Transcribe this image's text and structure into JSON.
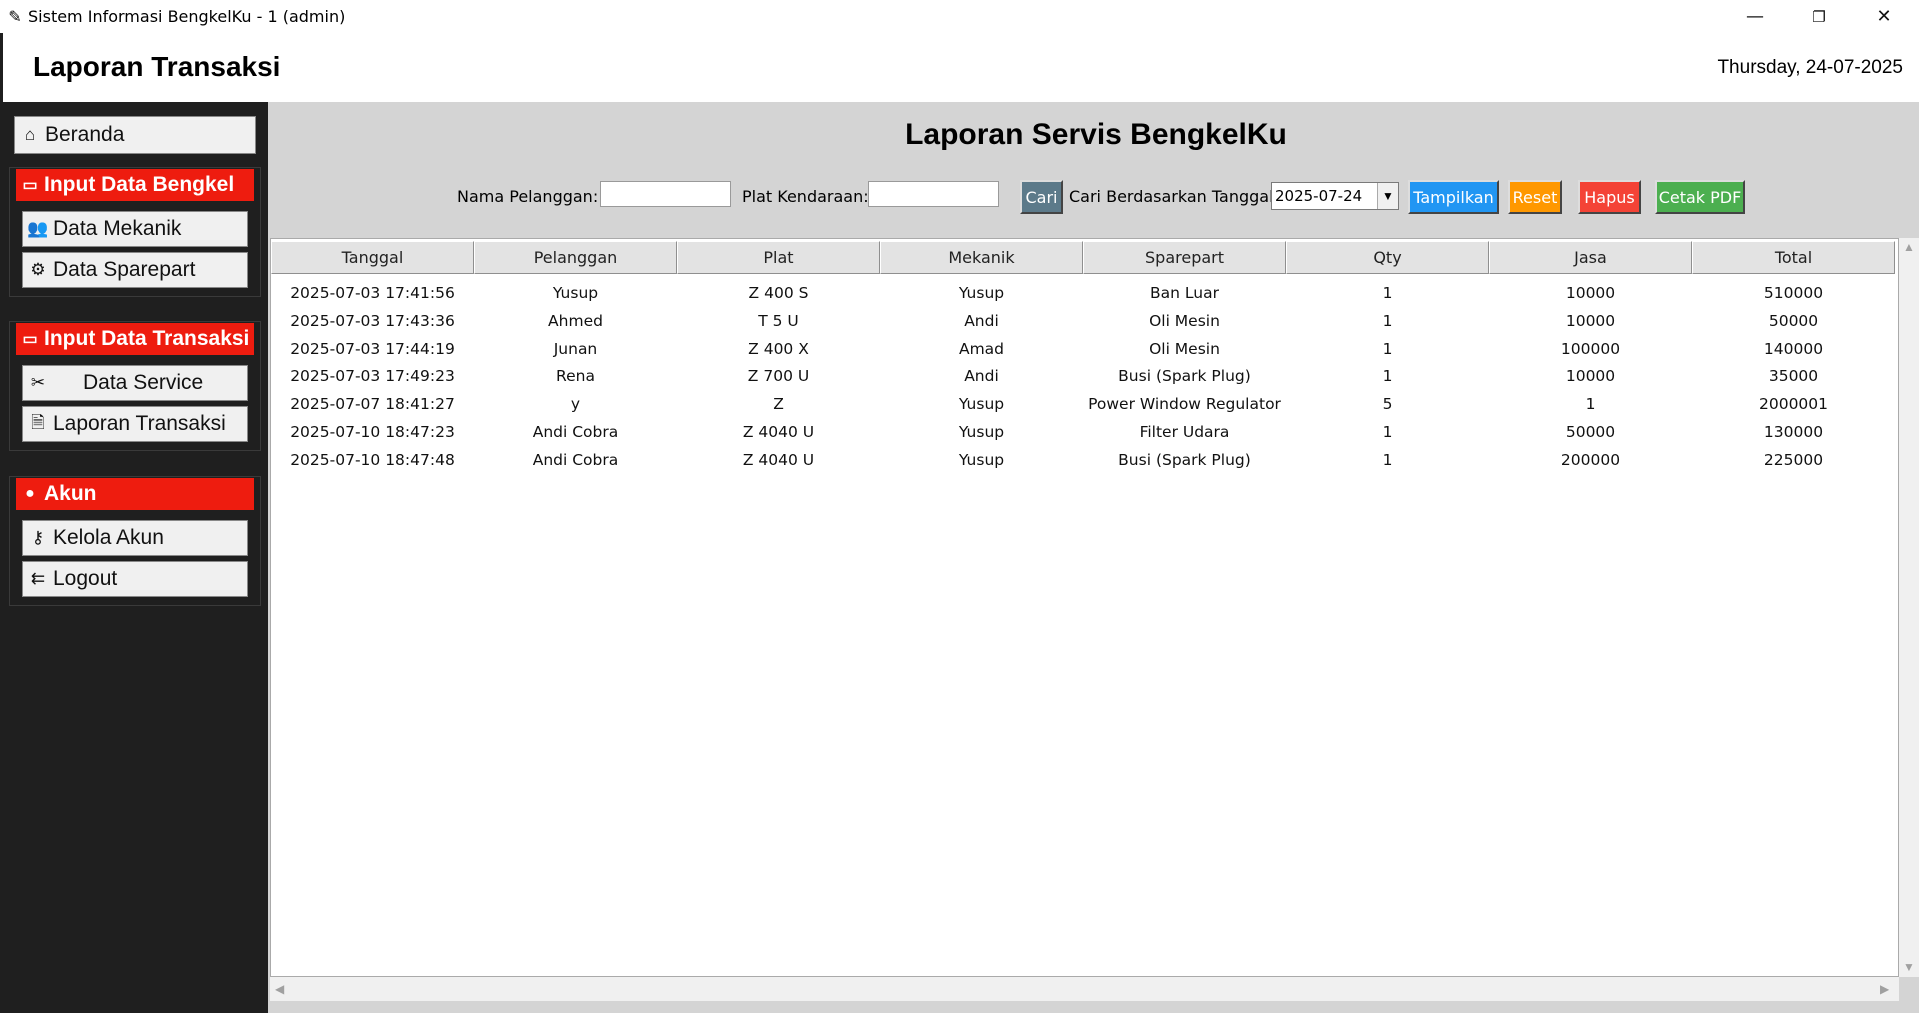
{
  "window": {
    "title": "Sistem Informasi BengkelKu - 1 (admin)",
    "minimize": "—",
    "restore": "❐",
    "close": "✕"
  },
  "header": {
    "title": "Laporan Transaksi",
    "date": "Thursday, 24-07-2025"
  },
  "sidebar": {
    "home": "Beranda",
    "groups": [
      {
        "title": "Input Data Bengkel",
        "items": [
          "Data Mekanik",
          "Data Sparepart"
        ]
      },
      {
        "title": "Input Data Transaksi",
        "items": [
          "Data Service",
          "Laporan Transaksi"
        ]
      },
      {
        "title": "Akun",
        "items": [
          "Kelola Akun",
          "Logout"
        ]
      }
    ]
  },
  "report": {
    "title": "Laporan Servis BengkelKu",
    "filters": {
      "customer_label": "Nama Pelanggan:",
      "customer_value": "",
      "plate_label": "Plat Kendaraan:",
      "plate_value": "",
      "search_button": "Cari",
      "date_label": "Cari Berdasarkan Tanggal:",
      "date_value": "2025-07-24"
    },
    "buttons": {
      "show": "Tampilkan",
      "reset": "Reset",
      "delete": "Hapus",
      "print_pdf": "Cetak PDF"
    },
    "colors": {
      "search": "#5c7a8a",
      "show": "#2196f3",
      "reset": "#ff9800",
      "delete": "#f44336",
      "print_pdf": "#4caf50",
      "sidebar_header": "#ee1c0f"
    },
    "table": {
      "columns": [
        "Tanggal",
        "Pelanggan",
        "Plat",
        "Mekanik",
        "Sparepart",
        "Qty",
        "Jasa",
        "Total"
      ],
      "rows": [
        [
          "2025-07-03 17:41:56",
          "Yusup",
          "Z 400 S",
          "Yusup",
          "Ban Luar",
          "1",
          "10000",
          "510000"
        ],
        [
          "2025-07-03 17:43:36",
          "Ahmed",
          "T 5 U",
          "Andi",
          "Oli Mesin",
          "1",
          "10000",
          "50000"
        ],
        [
          "2025-07-03 17:44:19",
          "Junan",
          "Z 400 X",
          "Amad",
          "Oli Mesin",
          "1",
          "100000",
          "140000"
        ],
        [
          "2025-07-03 17:49:23",
          "Rena",
          "Z 700 U",
          "Andi",
          "Busi (Spark Plug)",
          "1",
          "10000",
          "35000"
        ],
        [
          "2025-07-07 18:41:27",
          "y",
          "Z",
          "Yusup",
          "Power Window Regulator",
          "5",
          "1",
          "2000001"
        ],
        [
          "2025-07-10 18:47:23",
          "Andi Cobra",
          "Z 4040 U",
          "Yusup",
          "Filter Udara",
          "1",
          "50000",
          "130000"
        ],
        [
          "2025-07-10 18:47:48",
          "Andi Cobra",
          "Z 4040 U",
          "Yusup",
          "Busi (Spark Plug)",
          "1",
          "200000",
          "225000"
        ]
      ]
    }
  }
}
